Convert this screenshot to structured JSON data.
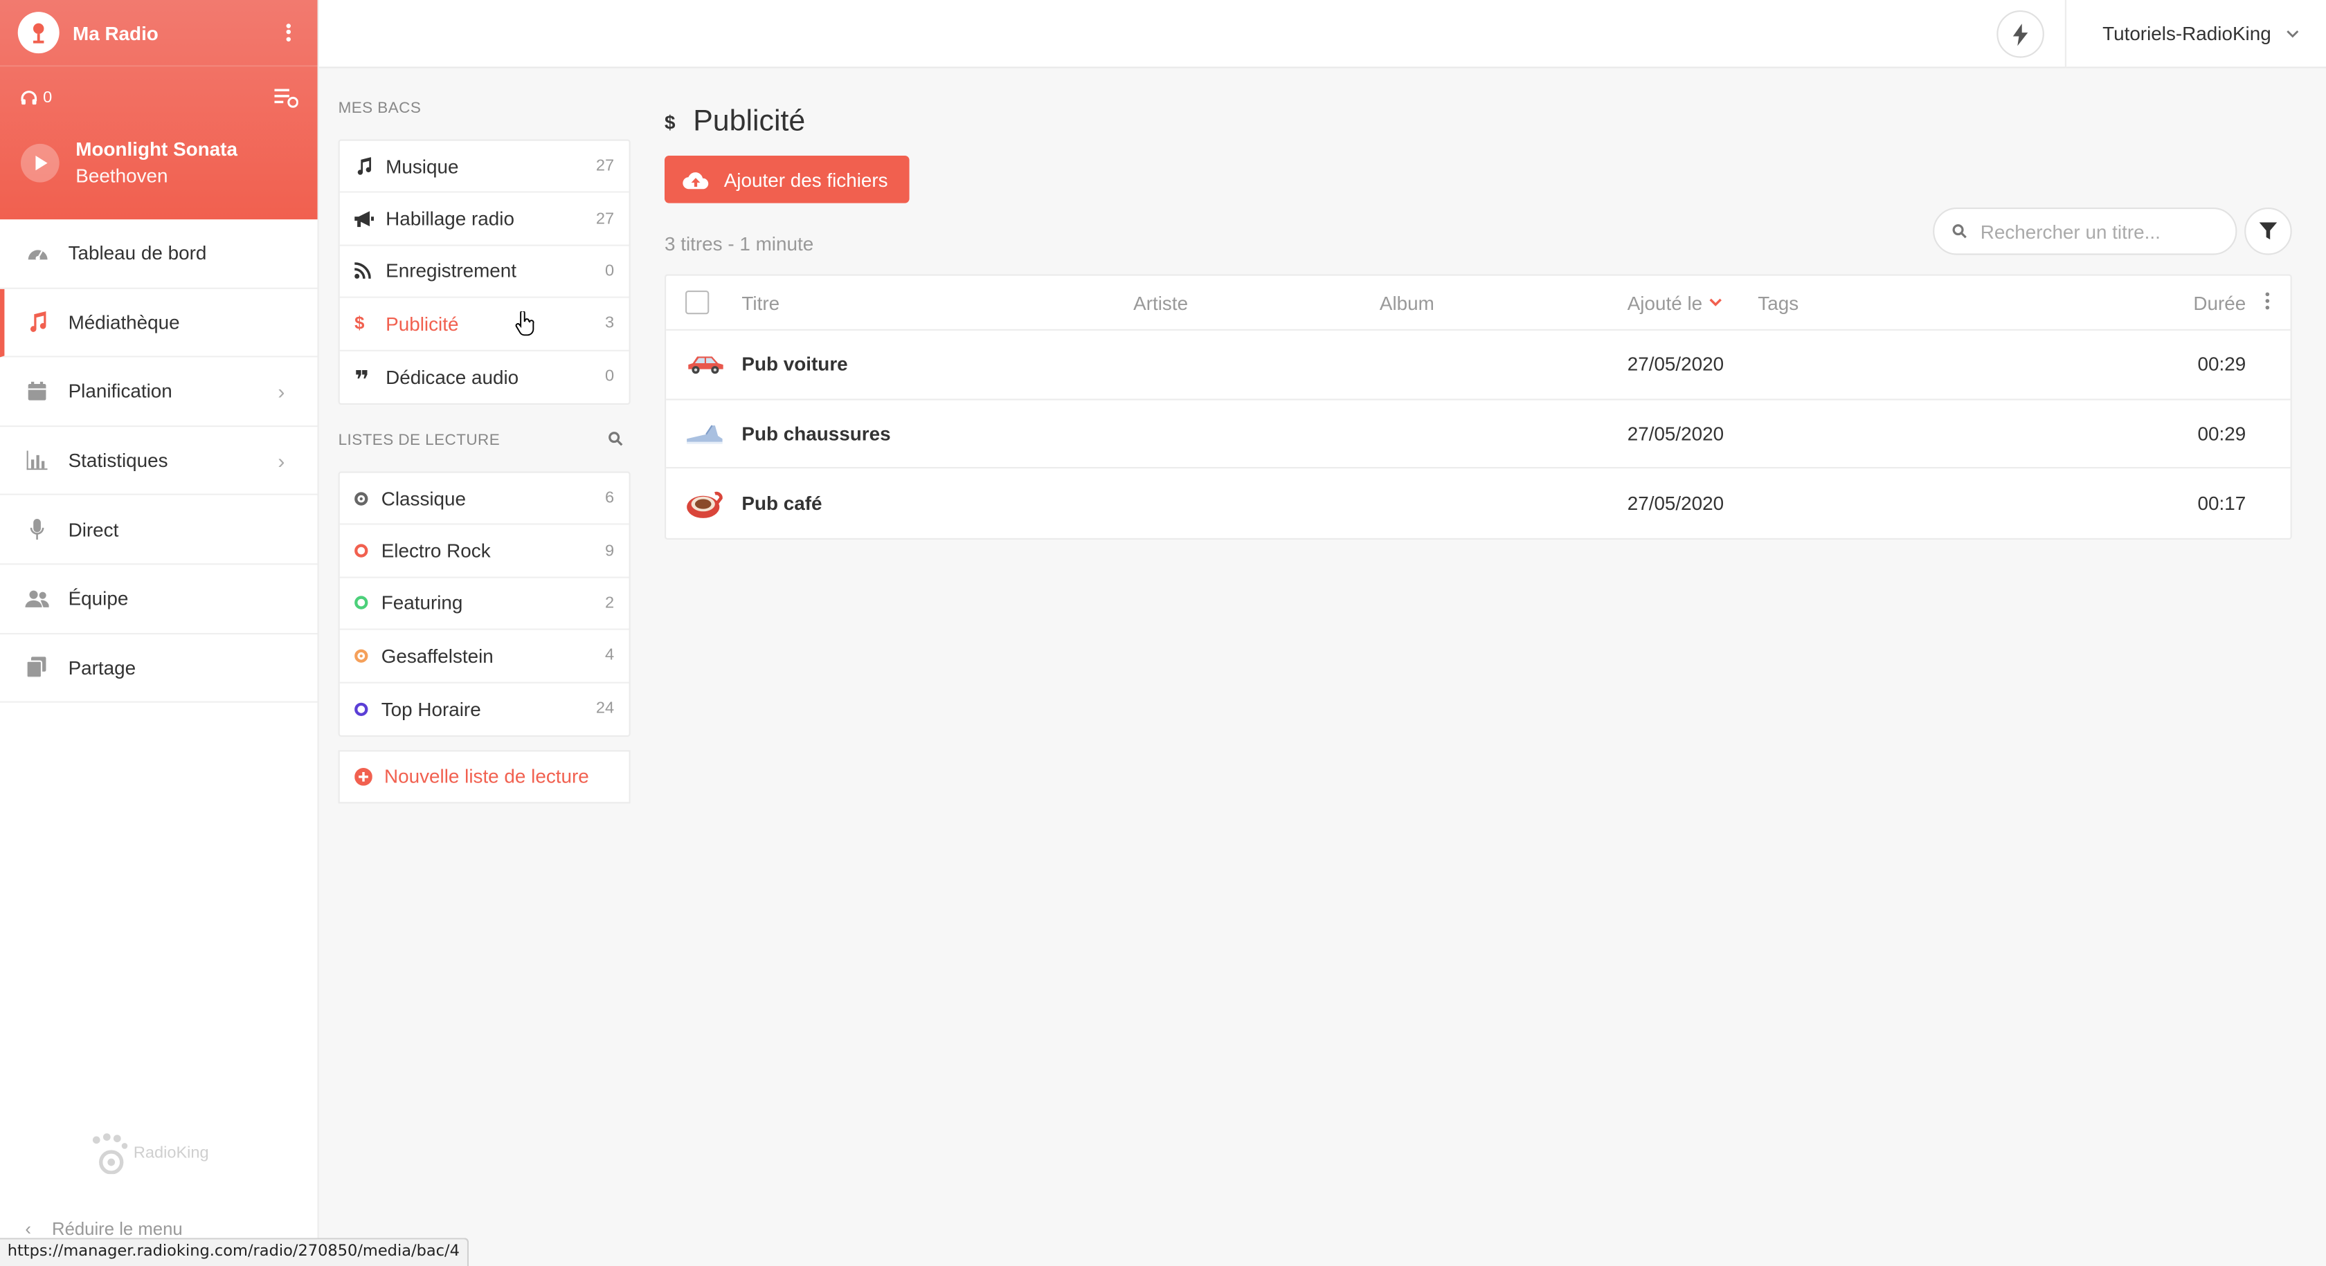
{
  "sidebar": {
    "radio_name": "Ma Radio",
    "listeners": "0",
    "now_playing": {
      "title": "Moonlight Sonata",
      "artist": "Beethoven"
    },
    "nav": [
      {
        "label": "Tableau de bord",
        "icon": "dashboard-icon"
      },
      {
        "label": "Médiathèque",
        "icon": "music-note-icon",
        "active": true
      },
      {
        "label": "Planification",
        "icon": "calendar-icon",
        "chevron": true
      },
      {
        "label": "Statistiques",
        "icon": "bar-chart-icon",
        "chevron": true
      },
      {
        "label": "Direct",
        "icon": "microphone-icon"
      },
      {
        "label": "Équipe",
        "icon": "team-icon"
      },
      {
        "label": "Partage",
        "icon": "share-icon"
      }
    ],
    "brand": "RadioKing",
    "collapse_label": "Réduire le menu",
    "status_url": "https://manager.radioking.com/radio/270850/media/bac/4"
  },
  "topbar": {
    "account": "Tutoriels-RadioKing"
  },
  "bins": {
    "title": "MES BACS",
    "items": [
      {
        "label": "Musique",
        "count": "27",
        "icon": "music-note-icon"
      },
      {
        "label": "Habillage radio",
        "count": "27",
        "icon": "megaphone-icon"
      },
      {
        "label": "Enregistrement",
        "count": "0",
        "icon": "rss-icon"
      },
      {
        "label": "Publicité",
        "count": "3",
        "icon": "dollar-icon",
        "active": true
      },
      {
        "label": "Dédicace audio",
        "count": "0",
        "icon": "quote-icon"
      }
    ]
  },
  "playlists": {
    "title": "LISTES DE LECTURE",
    "items": [
      {
        "label": "Classique",
        "count": "6",
        "color": "#666666"
      },
      {
        "label": "Electro Rock",
        "count": "9",
        "color": "#f1604f"
      },
      {
        "label": "Featuring",
        "count": "2",
        "color": "#4cd07a"
      },
      {
        "label": "Gesaffelstein",
        "count": "4",
        "color": "#f5a05a"
      },
      {
        "label": "Top Horaire",
        "count": "24",
        "color": "#5b3fd6"
      }
    ],
    "new_label": "Nouvelle liste de lecture"
  },
  "main": {
    "title": "Publicité",
    "add_label": "Ajouter des fichiers",
    "summary": "3 titres - 1 minute",
    "search_placeholder": "Rechercher un titre...",
    "columns": {
      "title": "Titre",
      "artist": "Artiste",
      "album": "Album",
      "added": "Ajouté le",
      "tags": "Tags",
      "duration": "Durée"
    },
    "rows": [
      {
        "title": "Pub voiture",
        "artist": "",
        "album": "",
        "added": "27/05/2020",
        "tags": "",
        "duration": "00:29",
        "thumb": "car-icon"
      },
      {
        "title": "Pub chaussures",
        "artist": "",
        "album": "",
        "added": "27/05/2020",
        "tags": "",
        "duration": "00:29",
        "thumb": "shoe-icon"
      },
      {
        "title": "Pub café",
        "artist": "",
        "album": "",
        "added": "27/05/2020",
        "tags": "",
        "duration": "00:17",
        "thumb": "coffee-icon"
      }
    ]
  },
  "colors": {
    "accent": "#f1604f",
    "header_gradient_top": "#f27a6f"
  }
}
